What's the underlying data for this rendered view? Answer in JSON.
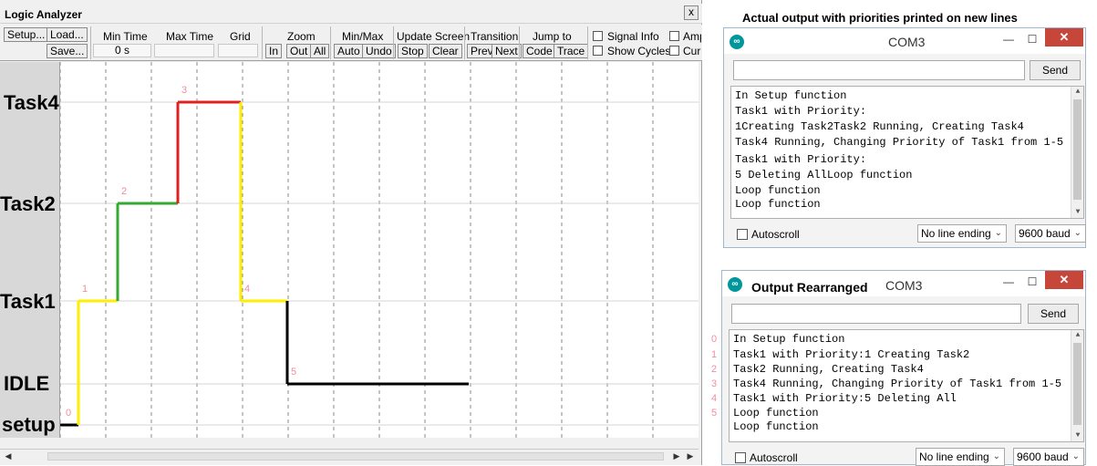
{
  "logic_analyzer": {
    "title": "Logic Analyzer",
    "close_label": "x",
    "buttons": {
      "setup": "Setup...",
      "load": "Load...",
      "save": "Save...",
      "zoom_in": "In",
      "zoom_out": "Out",
      "zoom_all": "All",
      "auto": "Auto",
      "undo": "Undo",
      "stop": "Stop",
      "clear": "Clear",
      "prev": "Prev",
      "next": "Next",
      "code": "Code",
      "trace": "Trace"
    },
    "groups": {
      "min_time": "Min Time",
      "max_time": "Max Time",
      "grid": "Grid",
      "zoom": "Zoom",
      "min_max": "Min/Max",
      "update_screen": "Update Screen",
      "transition": "Transition",
      "jump_to": "Jump to"
    },
    "values": {
      "min_time": "0 s",
      "max_time": "",
      "grid": ""
    },
    "options": {
      "signal_info": "Signal Info",
      "show_cycles": "Show Cycles",
      "amp": "Amp",
      "cur": "Cur"
    },
    "signals": [
      "Task4",
      "Task2",
      "Task1",
      "IDLE",
      "setup"
    ],
    "trace": {
      "points": [
        {
          "label": "0",
          "signal": "setup",
          "color": "#000000"
        },
        {
          "label": "1",
          "signal": "Task1",
          "color": "#ffee00"
        },
        {
          "label": "2",
          "signal": "Task2",
          "color": "#33aa33"
        },
        {
          "label": "3",
          "signal": "Task4",
          "color": "#e02020"
        },
        {
          "label": "4",
          "signal": "Task1",
          "color": "#ffee00"
        },
        {
          "label": "5",
          "signal": "IDLE",
          "color": "#000000"
        }
      ],
      "marker_color": "#f08ea0",
      "grid_color": "#888888"
    }
  },
  "heading": "Actual output with priorities printed on new lines",
  "monitor_top": {
    "port": "COM3",
    "title_label": "",
    "send_label": "Send",
    "input_value": "",
    "lines": [
      "In Setup function",
      "Task1 with Priority:",
      "1Creating Task2Task2 Running, Creating Task4",
      "Task4 Running, Changing Priority of Task1 from 1-5",
      "Task1 with Priority:",
      "5 Deleting AllLoop function",
      "Loop function",
      "Loop function"
    ],
    "autoscroll": "Autoscroll",
    "line_ending": "No line ending",
    "baud": "9600 baud"
  },
  "monitor_bottom": {
    "port": "COM3",
    "title_label": "Output Rearranged",
    "send_label": "Send",
    "input_value": "",
    "lines": [
      "In Setup function",
      "Task1 with Priority:1 Creating Task2",
      "Task2 Running, Creating Task4",
      "Task4 Running, Changing Priority of Task1 from 1-5",
      "Task1 with Priority:5 Deleting All",
      "Loop function",
      "Loop function"
    ],
    "line_numbers": [
      "0",
      "1",
      "2",
      "3",
      "4",
      "5"
    ],
    "autoscroll": "Autoscroll",
    "line_ending": "No line ending",
    "baud": "9600 baud"
  },
  "colors": {
    "close_red": "#c7463a",
    "arduino_teal": "#00979c"
  }
}
